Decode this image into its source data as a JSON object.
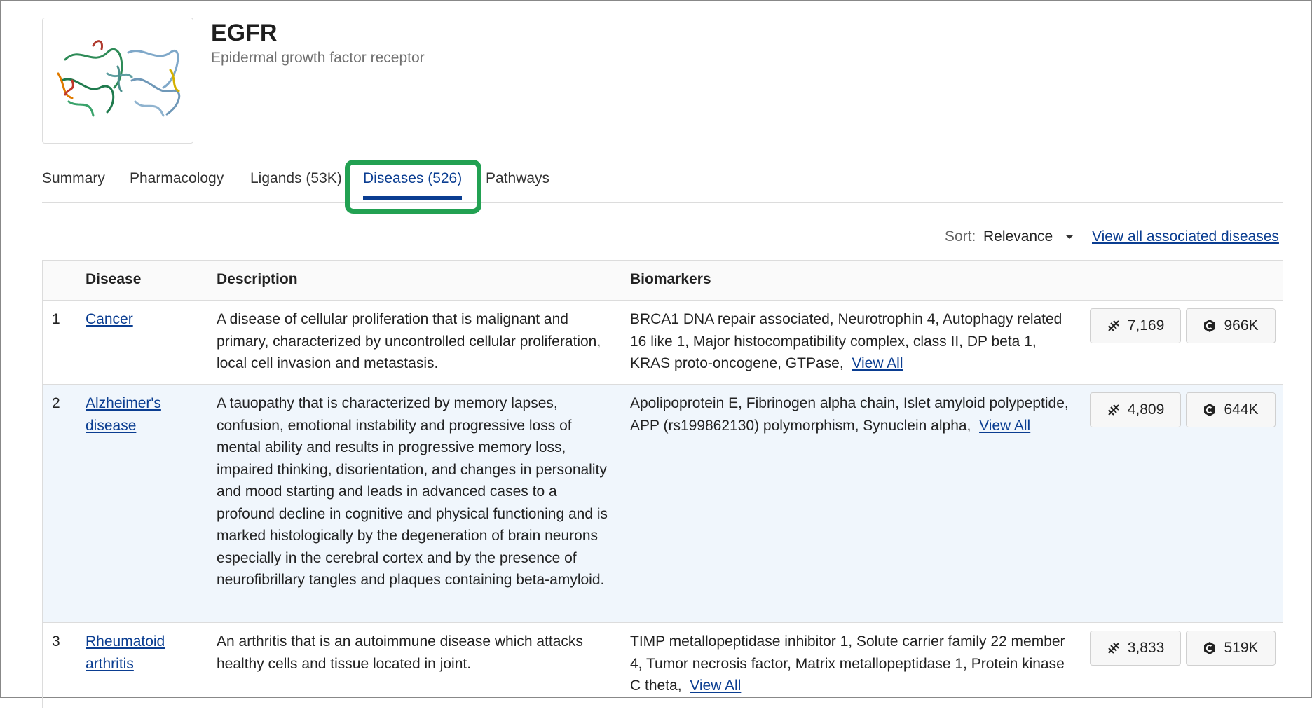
{
  "header": {
    "symbol": "EGFR",
    "name": "Epidermal growth factor receptor",
    "structure_icon": "protein-structure-icon"
  },
  "tabs": [
    {
      "label": "Summary"
    },
    {
      "label": "Pharmacology"
    },
    {
      "label": "Ligands (53K)"
    },
    {
      "label": "Diseases (526)",
      "active": true
    },
    {
      "label": "Pathways"
    }
  ],
  "sort": {
    "label": "Sort:",
    "value": "Relevance",
    "view_all": "View all associated diseases"
  },
  "table": {
    "headers": {
      "disease": "Disease",
      "description": "Description",
      "biomarkers": "Biomarkers"
    },
    "rows": [
      {
        "num": "1",
        "disease": "Cancer",
        "description": "A disease of cellular proliferation that is malignant and primary, characterized by uncontrolled cellular proliferation, local cell invasion and metastasis.",
        "biomarkers": "BRCA1 DNA repair associated,  Neurotrophin 4,  Autophagy related 16 like 1,  Major histocompatibility complex, class II, DP beta 1,  KRAS proto-oncogene, GTPase,",
        "view_all": "View All",
        "count1": "7,169",
        "count2": "966K"
      },
      {
        "num": "2",
        "disease": "Alzheimer's disease",
        "description": "A tauopathy that is characterized by memory lapses, confusion, emotional instability and progressive loss of mental ability and results in progressive memory loss, impaired thinking, disorientation, and changes in personality and mood starting and leads in advanced cases to a profound decline in cognitive and physical functioning and is marked histologically by the degeneration of brain neurons especially in the cerebral cortex and by the presence of neurofibrillary tangles and plaques containing beta-amyloid.",
        "biomarkers": "Apolipoprotein E,  Fibrinogen alpha chain,  Islet amyloid polypeptide,  APP (rs199862130) polymorphism,  Synuclein alpha,",
        "view_all": "View All",
        "count1": "4,809",
        "count2": "644K"
      },
      {
        "num": "3",
        "disease": "Rheumatoid arthritis",
        "description": "An arthritis that is an autoimmune disease which attacks healthy cells and tissue located in joint.",
        "biomarkers": "TIMP metallopeptidase inhibitor 1,  Solute carrier family 22 member 4,  Tumor necrosis factor,  Matrix metallopeptidase 1,  Protein kinase C theta,",
        "view_all": "View All",
        "count1": "3,833",
        "count2": "519K"
      }
    ]
  },
  "icons": {
    "count1": "dna-icon",
    "count2": "compound-icon"
  },
  "colors": {
    "link": "#0a3d91",
    "highlight": "#22a152",
    "alt_row": "#f0f6fc"
  }
}
